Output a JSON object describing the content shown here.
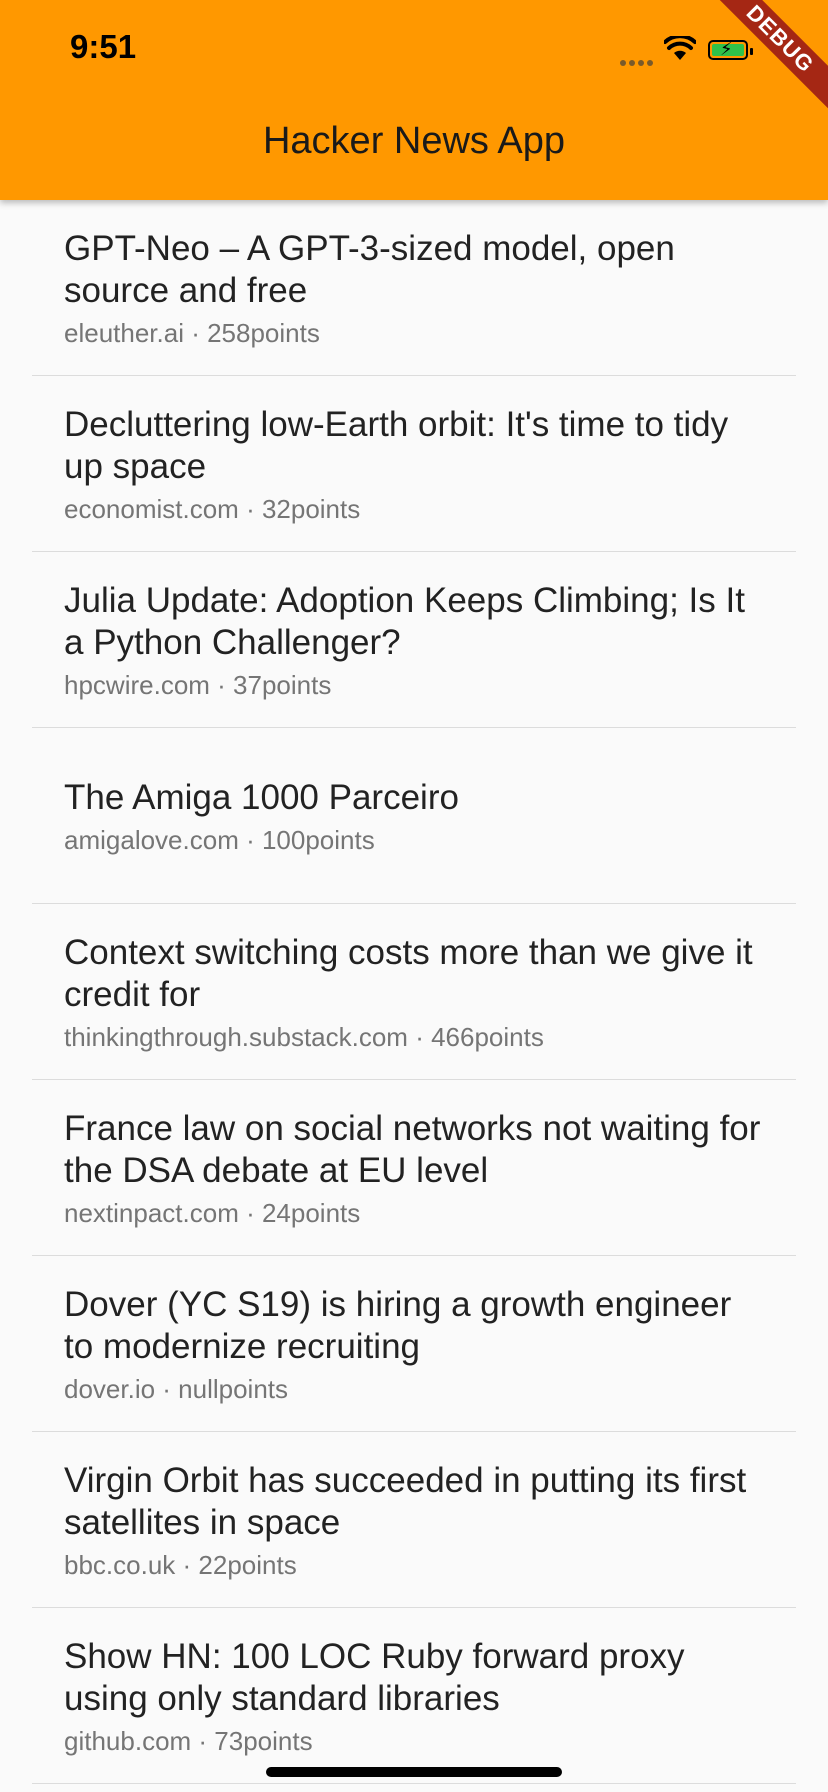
{
  "status_bar": {
    "time": "9:51",
    "icons": [
      "signal-dots-icon",
      "wifi-icon",
      "battery-charging-icon"
    ]
  },
  "app_bar": {
    "title": "Hacker News App",
    "color": "#ff9800"
  },
  "debug_banner": {
    "label": "DEBUG",
    "color": "#a52714"
  },
  "stories": [
    {
      "title": "GPT-Neo – A GPT-3-sized model, open source and free",
      "subtitle": "eleuther.ai · 258points"
    },
    {
      "title": "Decluttering low-Earth orbit: It's time to tidy up space",
      "subtitle": "economist.com · 32points"
    },
    {
      "title": "Julia Update: Adoption Keeps Climbing; Is It a Python Challenger?",
      "subtitle": "hpcwire.com · 37points"
    },
    {
      "title": "The Amiga 1000 Parceiro",
      "subtitle": "amigalove.com · 100points"
    },
    {
      "title": "Context switching costs more than we give it credit for",
      "subtitle": "thinkingthrough.substack.com · 466points"
    },
    {
      "title": "France law on social networks not waiting for the DSA debate at EU level",
      "subtitle": "nextinpact.com · 24points"
    },
    {
      "title": "Dover (YC S19) is hiring a growth engineer to modernize recruiting",
      "subtitle": "dover.io · nullpoints"
    },
    {
      "title": "Virgin Orbit has succeeded in putting its first satellites in space",
      "subtitle": "bbc.co.uk · 22points"
    },
    {
      "title": "Show HN: 100 LOC Ruby forward proxy using only standard libraries",
      "subtitle": "github.com · 73points"
    }
  ]
}
